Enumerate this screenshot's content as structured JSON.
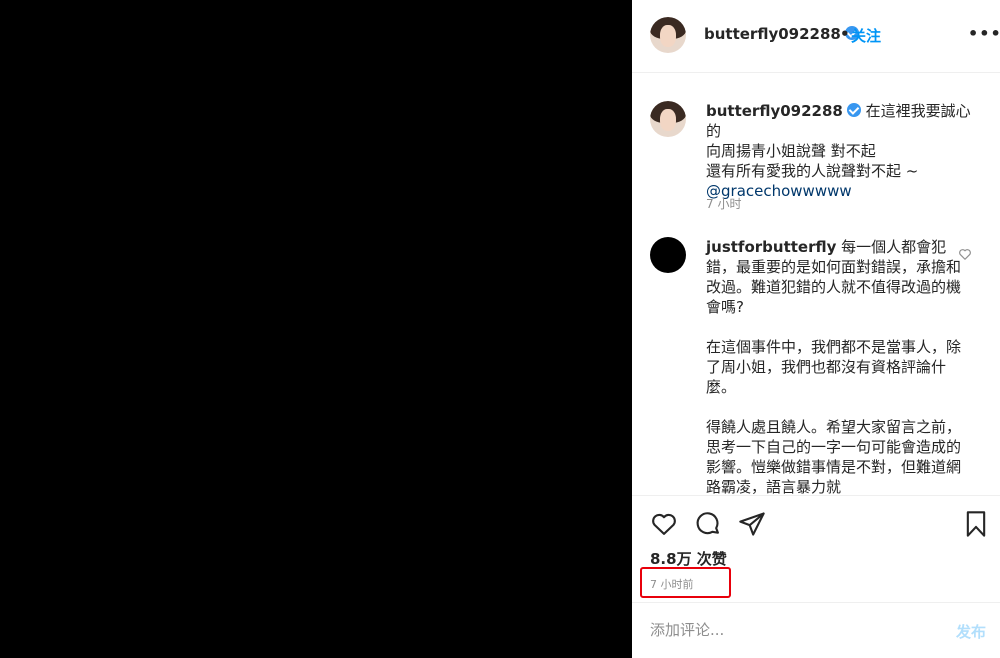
{
  "header": {
    "username": "butterfly092288",
    "separator": "•",
    "follow_label": "关注",
    "more_label": "•••",
    "verified_icon": "verified-badge-icon"
  },
  "caption": {
    "username": "butterfly092288",
    "text_line1": "在這裡我要誠心的",
    "text_line2": "向周揚青小姐說聲 對不起",
    "text_line3": "還有所有愛我的人說聲對不起 ~",
    "mention": "@gracechowwwww",
    "time": "7 小时"
  },
  "comment": {
    "username": "justforbutterfly",
    "text": " 每一個人都會犯錯，最重要的是如何面對錯誤，承擔和改過。難道犯錯的人就不值得改過的機會嗎?\n\n在這個事件中，我們都不是當事人，除了周小姐，我們也都沒有資格評論什麼。\n\n得饒人處且饒人。希望大家留言之前，思考一下自己的一字一句可能會造成的影響。愷樂做錯事情是不對，但難道網路霸凌，語言暴力就"
  },
  "stats": {
    "views": "8.8万 次赞",
    "posted": "7 小时前"
  },
  "composer": {
    "placeholder": "添加评论...",
    "post_label": "发布"
  },
  "colors": {
    "accent": "#0095f6",
    "post_disabled": "#b2dffc",
    "highlight": "#e8000b"
  }
}
